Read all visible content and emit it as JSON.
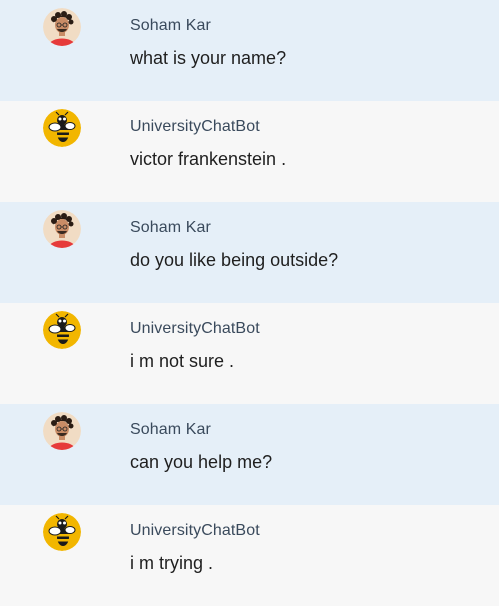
{
  "messages": [
    {
      "role": "user",
      "sender": "Soham Kar",
      "text": "what is your name?",
      "avatar_icon": "user-photo-avatar-icon"
    },
    {
      "role": "bot",
      "sender": "UniversityChatBot",
      "text": "victor frankenstein .",
      "avatar_icon": "yellow-jacket-bee-icon"
    },
    {
      "role": "user",
      "sender": "Soham Kar",
      "text": "do you like being outside?",
      "avatar_icon": "user-photo-avatar-icon"
    },
    {
      "role": "bot",
      "sender": "UniversityChatBot",
      "text": "i m not sure .",
      "avatar_icon": "yellow-jacket-bee-icon"
    },
    {
      "role": "user",
      "sender": "Soham Kar",
      "text": "can you help me?",
      "avatar_icon": "user-photo-avatar-icon"
    },
    {
      "role": "bot",
      "sender": "UniversityChatBot",
      "text": "i m trying .",
      "avatar_icon": "yellow-jacket-bee-icon"
    }
  ],
  "colors": {
    "user_row_bg": "#e5eff8",
    "bot_row_bg": "#f7f7f7",
    "sender_name": "#3a4a5c",
    "message_text": "#1f1f1f",
    "bot_avatar_bg": "#f2b600"
  }
}
